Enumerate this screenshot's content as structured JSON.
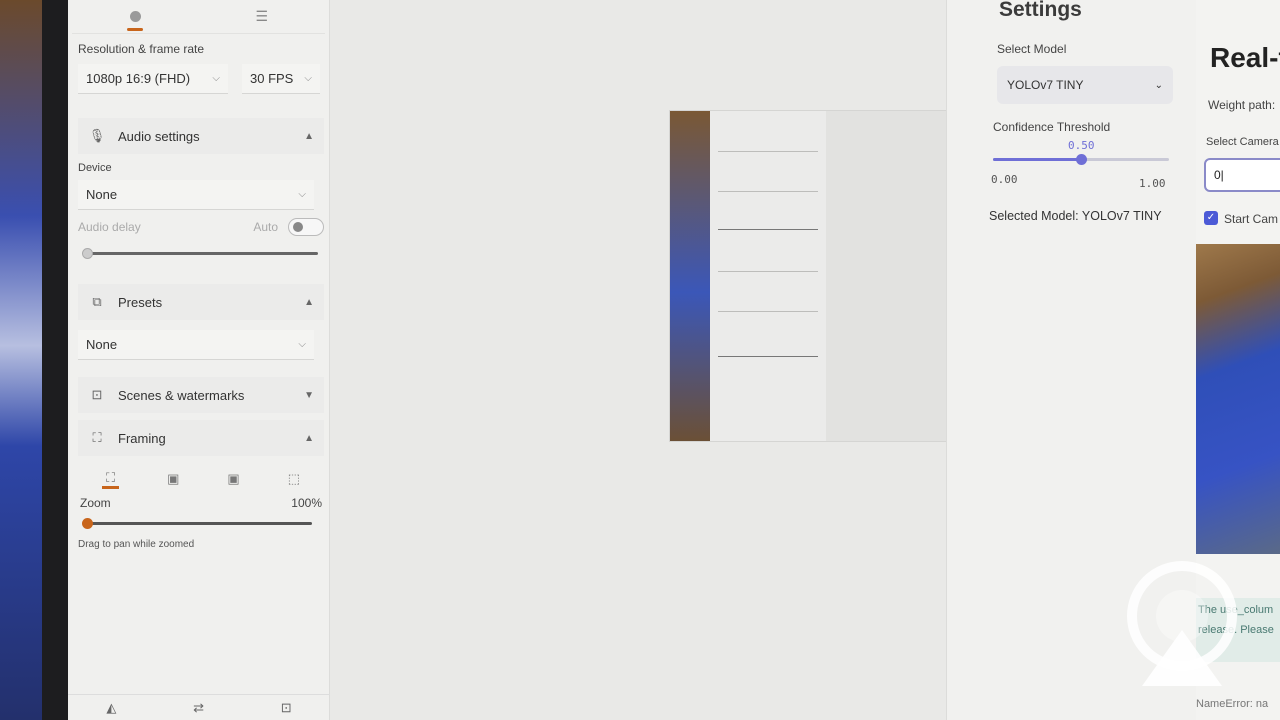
{
  "camera_panel": {
    "resolution_label": "Resolution & frame rate",
    "resolution_value": "1080p 16:9 (FHD)",
    "fps_value": "30 FPS",
    "audio_settings_title": "Audio settings",
    "device_label": "Device",
    "device_value": "None",
    "audio_delay_label": "Audio delay",
    "auto_label": "Auto",
    "presets_title": "Presets",
    "presets_value": "None",
    "scenes_title": "Scenes & watermarks",
    "framing_title": "Framing",
    "zoom_label": "Zoom",
    "zoom_value": "100%",
    "zoom_level": 0,
    "drag_hint": "Drag to pan while zoomed",
    "accent_color": "#c8651b"
  },
  "streamlit_sidebar": {
    "title": "Settings",
    "select_model_label": "Select Model",
    "select_model_value": "YOLOv7 TINY",
    "confidence_label": "Confidence Threshold",
    "confidence_value": "0.50",
    "confidence_level": 0.5,
    "slider_min": "0.00",
    "slider_max": "1.00",
    "selected_model_text": "Selected Model: YOLOv7 TINY",
    "accent_color": "#6f6fd6"
  },
  "streamlit_main": {
    "heading": "Real-t",
    "weight_path_label": "Weight path:",
    "select_camera_label": "Select Camera",
    "camera_input_value": "0|",
    "start_camera_label": "Start Cam",
    "info_line1": "The use_colum",
    "info_line2": "release. Please",
    "error_text": "NameError: na"
  }
}
